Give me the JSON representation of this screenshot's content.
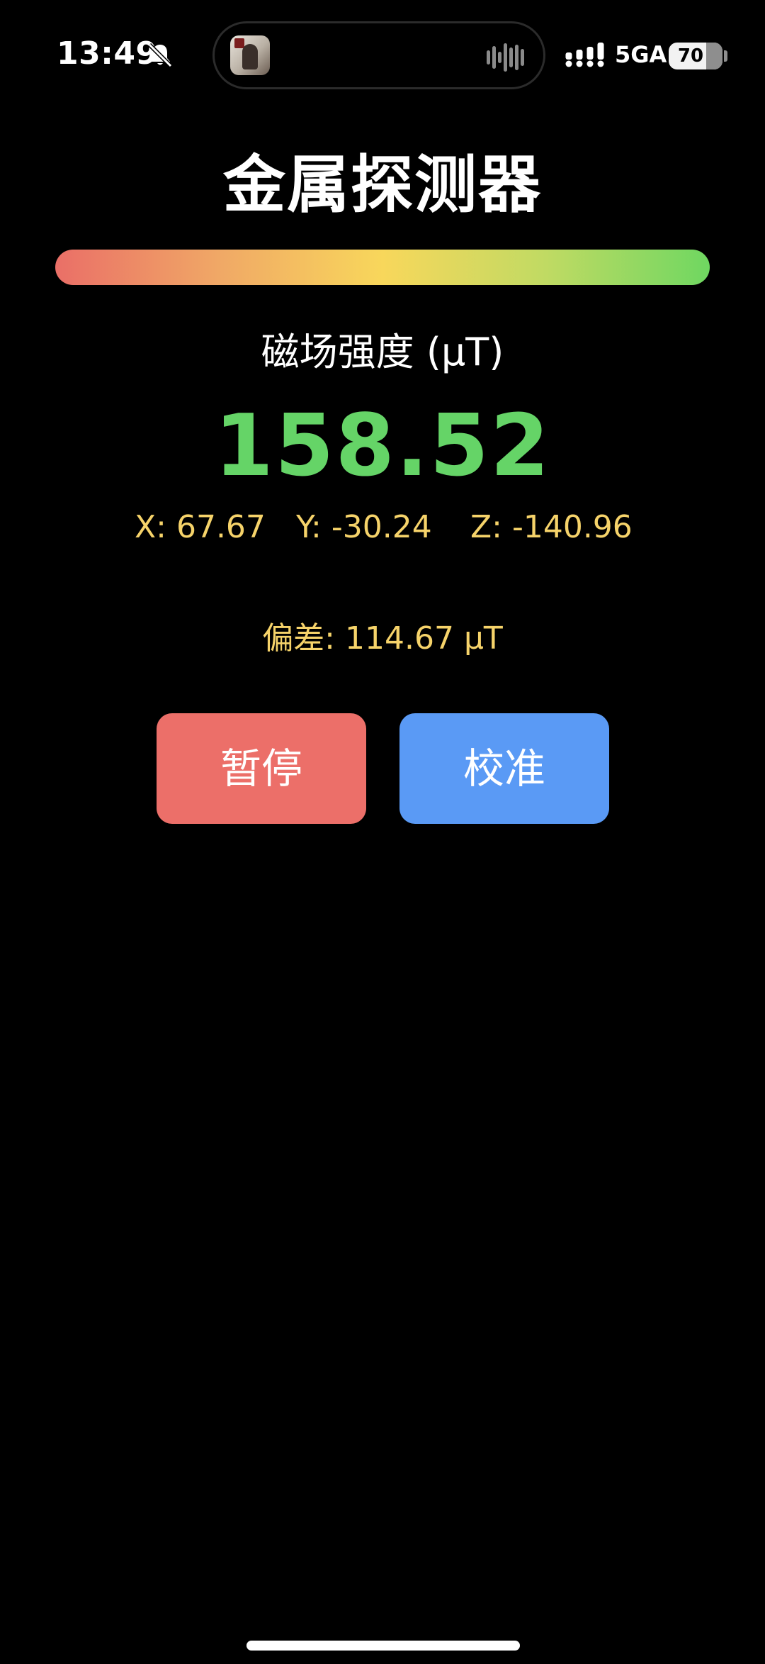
{
  "status_bar": {
    "time": "13:49",
    "network": "5GA",
    "battery_percent": "70",
    "battery_level": 0.7,
    "silent_icon": "bell-slash-icon",
    "live_activity_icon": "app-thumbnail",
    "sound_icon": "waveform-icon",
    "signal_icon": "cellular-signal-icon"
  },
  "app": {
    "title": "金属探测器",
    "gradient_colors": [
      "#ea6f67",
      "#f0a866",
      "#f8d75b",
      "#c0da63",
      "#6fd761"
    ],
    "field_label": "磁场强度 (μT)",
    "field_value": "158.52",
    "value_color": "#65d467",
    "axes": {
      "x": "X: 67.67",
      "y": "Y: -30.24",
      "z": "Z: -140.96"
    },
    "deviation": "偏差: 114.67 μT",
    "accent_text_color": "#f6d36a"
  },
  "buttons": {
    "pause_label": "暂停",
    "pause_color": "#ec6f69",
    "calibrate_label": "校准",
    "calibrate_color": "#5a9af5"
  }
}
